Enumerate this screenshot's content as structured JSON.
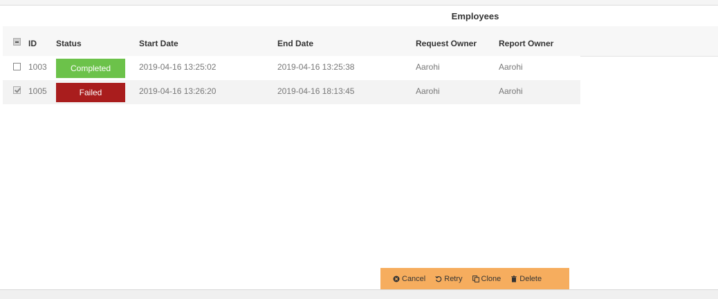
{
  "title": "Employees",
  "columns": {
    "id": "ID",
    "status": "Status",
    "start_date": "Start Date",
    "end_date": "End Date",
    "request_owner": "Request Owner",
    "report_owner": "Report Owner"
  },
  "rows": [
    {
      "checked": false,
      "id": "1003",
      "status": "Completed",
      "status_color": "#6cc24a",
      "start_date": "2019-04-16 13:25:02",
      "end_date": "2019-04-16 13:25:38",
      "request_owner": "Aarohi",
      "report_owner": "Aarohi"
    },
    {
      "checked": true,
      "id": "1005",
      "status": "Failed",
      "status_color": "#a91d1d",
      "start_date": "2019-04-16 13:26:20",
      "end_date": "2019-04-16 18:13:45",
      "request_owner": "Aarohi",
      "report_owner": "Aarohi"
    }
  ],
  "actions": {
    "cancel": "Cancel",
    "retry": "Retry",
    "clone": "Clone",
    "delete": "Delete"
  },
  "colors": {
    "action_bar": "#f6ad5e",
    "completed": "#6cc24a",
    "failed": "#a91d1d"
  }
}
